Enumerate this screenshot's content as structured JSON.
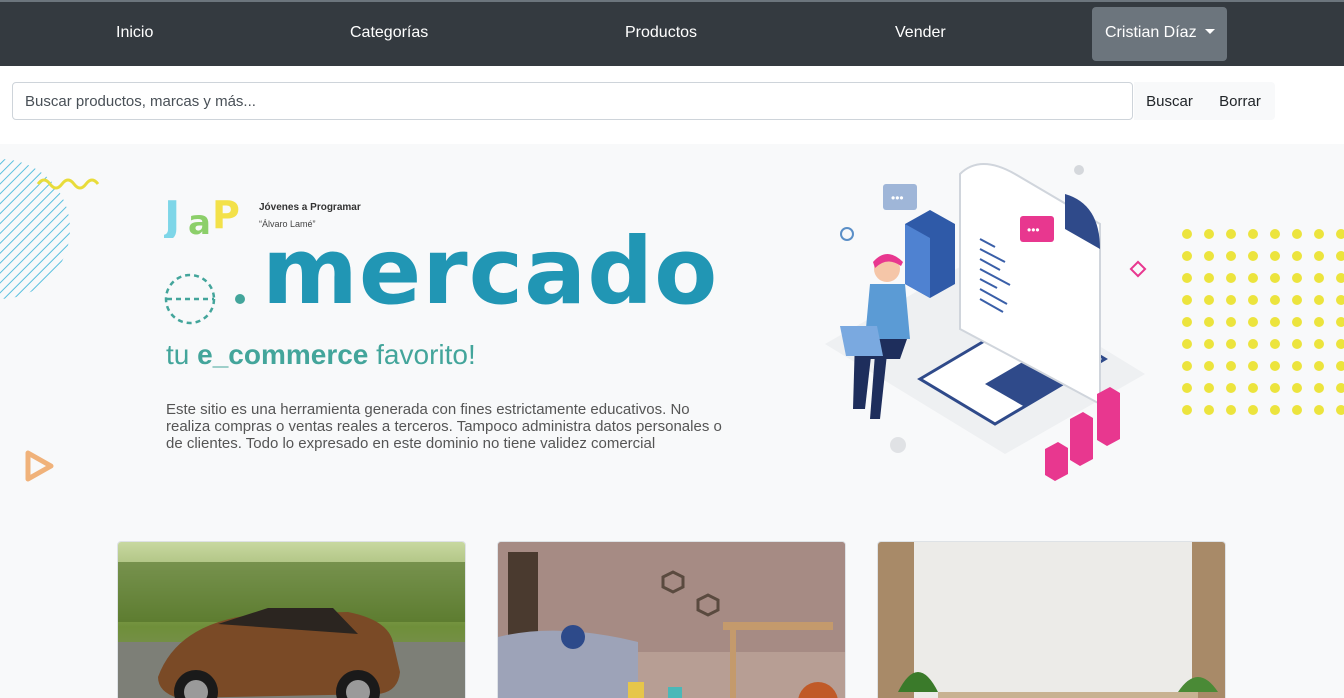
{
  "nav": {
    "items": [
      {
        "label": "Inicio"
      },
      {
        "label": "Categorías"
      },
      {
        "label": "Productos"
      },
      {
        "label": "Vender"
      }
    ],
    "user": {
      "label": "Cristian Díaz"
    }
  },
  "search": {
    "placeholder": "Buscar productos, marcas y más...",
    "value": "",
    "search_label": "Buscar",
    "clear_label": "Borrar"
  },
  "hero": {
    "logo_line1": "Jóvenes a Programar",
    "logo_line2": "“Álvaro Lamé”",
    "brand": "mercado",
    "tagline_pre": "tu ",
    "tagline_bold": "e_commerce",
    "tagline_post": " favorito!",
    "disclaimer": "Este sitio  es una herramienta generada con fines estrictamente educativos. No realiza compras o ventas reales a terceros. Tampoco administra datos personales o de clientes. Todo lo expresado en este dominio no tiene validez comercial"
  },
  "colors": {
    "navbar": "#343a40",
    "brand_blue": "#2196b4",
    "brand_green": "#43a59b",
    "accent_pink": "#e8378f",
    "accent_yellow": "#ece43d"
  }
}
